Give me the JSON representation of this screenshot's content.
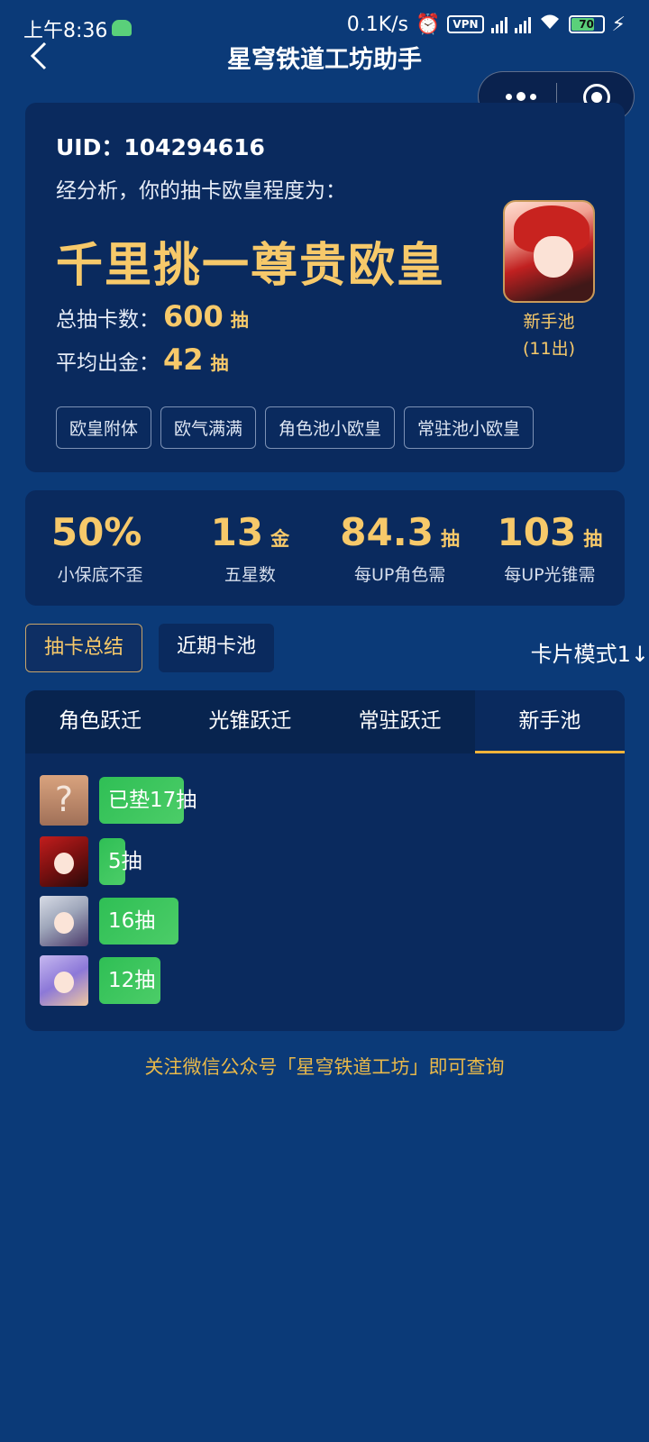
{
  "status_bar": {
    "time": "上午8:36",
    "speed": "0.1K/s",
    "vpn": "VPN",
    "battery": "70"
  },
  "nav": {
    "title": "星穹铁道工坊助手"
  },
  "result": {
    "uid": "UID：104294616",
    "analysis": "经分析，你的抽卡欧皇程度为：",
    "rank_title": "千里挑一尊贵欧皇",
    "total_label": "总抽卡数：",
    "total_value": "600",
    "total_unit": "抽",
    "avg_label": "平均出金：",
    "avg_value": "42",
    "avg_unit": "抽",
    "tags": [
      "欧皇附体",
      "欧气满满",
      "角色池小欧皇",
      "常驻池小欧皇"
    ],
    "pool_name": "新手池",
    "pool_count": "(11出)"
  },
  "stats": [
    {
      "value": "50%",
      "unit": "",
      "label": "小保底不歪"
    },
    {
      "value": "13",
      "unit": "金",
      "label": "五星数"
    },
    {
      "value": "84.3",
      "unit": "抽",
      "label": "每UP角色需"
    },
    {
      "value": "103",
      "unit": "抽",
      "label": "每UP光锥需"
    }
  ],
  "section_tabs": {
    "summary": "抽卡总结",
    "recent": "近期卡池",
    "card_mode": "卡片模式1↓"
  },
  "pool_tabs": [
    "角色跃迁",
    "光锥跃迁",
    "常驻跃迁",
    "新手池"
  ],
  "active_pool_tab": "新手池",
  "pulls": [
    {
      "text": "已垫17抽",
      "fraction": 0.18
    },
    {
      "text": "5抽",
      "fraction": 0.055
    },
    {
      "text": "16抽",
      "fraction": 0.17
    },
    {
      "text": "12抽",
      "fraction": 0.13
    }
  ],
  "footer": "关注微信公众号「星穹铁道工坊」即可查询",
  "colors": {
    "background": "#0b3a78",
    "card": "#0a2a5e",
    "gold": "#f7c96a",
    "bar_green": "#3cc45e",
    "tab_underline": "#f0b33a"
  }
}
